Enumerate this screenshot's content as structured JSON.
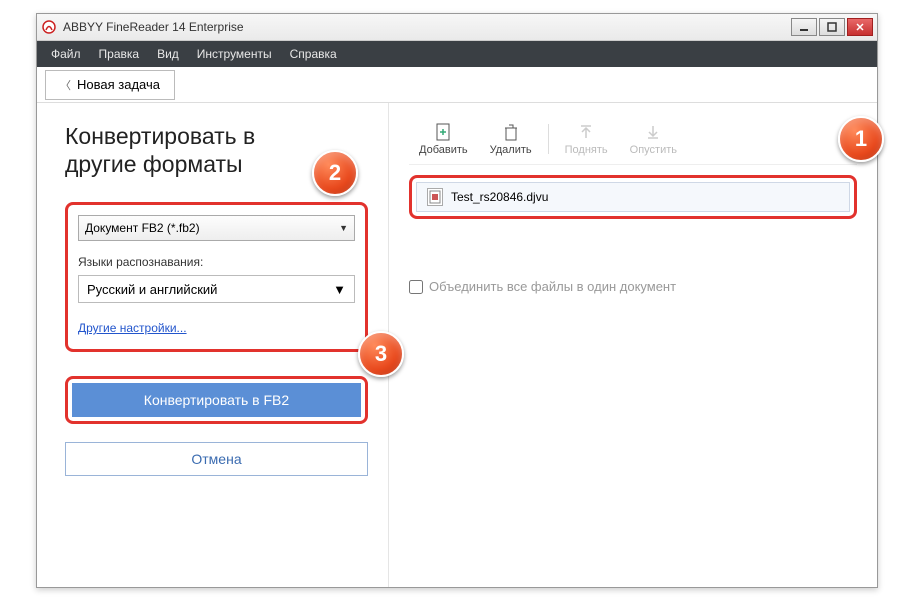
{
  "titlebar": {
    "text": "ABBYY FineReader 14 Enterprise"
  },
  "menu": {
    "file": "Файл",
    "edit": "Правка",
    "view": "Вид",
    "tools": "Инструменты",
    "help": "Справка"
  },
  "toolbar": {
    "new_task": "Новая задача"
  },
  "left": {
    "heading_line1": "Конвертировать в",
    "heading_line2": "другие форматы",
    "format_dropdown": "Документ FB2 (*.fb2)",
    "lang_label": "Языки распознавания:",
    "lang_value": "Русский и английский",
    "more_settings": "Другие настройки...",
    "convert_btn": "Конвертировать в FB2",
    "cancel_btn": "Отмена"
  },
  "right": {
    "add": "Добавить",
    "delete": "Удалить",
    "up": "Поднять",
    "down": "Опустить",
    "filename": "Test_rs20846.djvu",
    "merge_label": "Объединить все файлы в один документ"
  },
  "badges": {
    "b1": "1",
    "b2": "2",
    "b3": "3"
  }
}
